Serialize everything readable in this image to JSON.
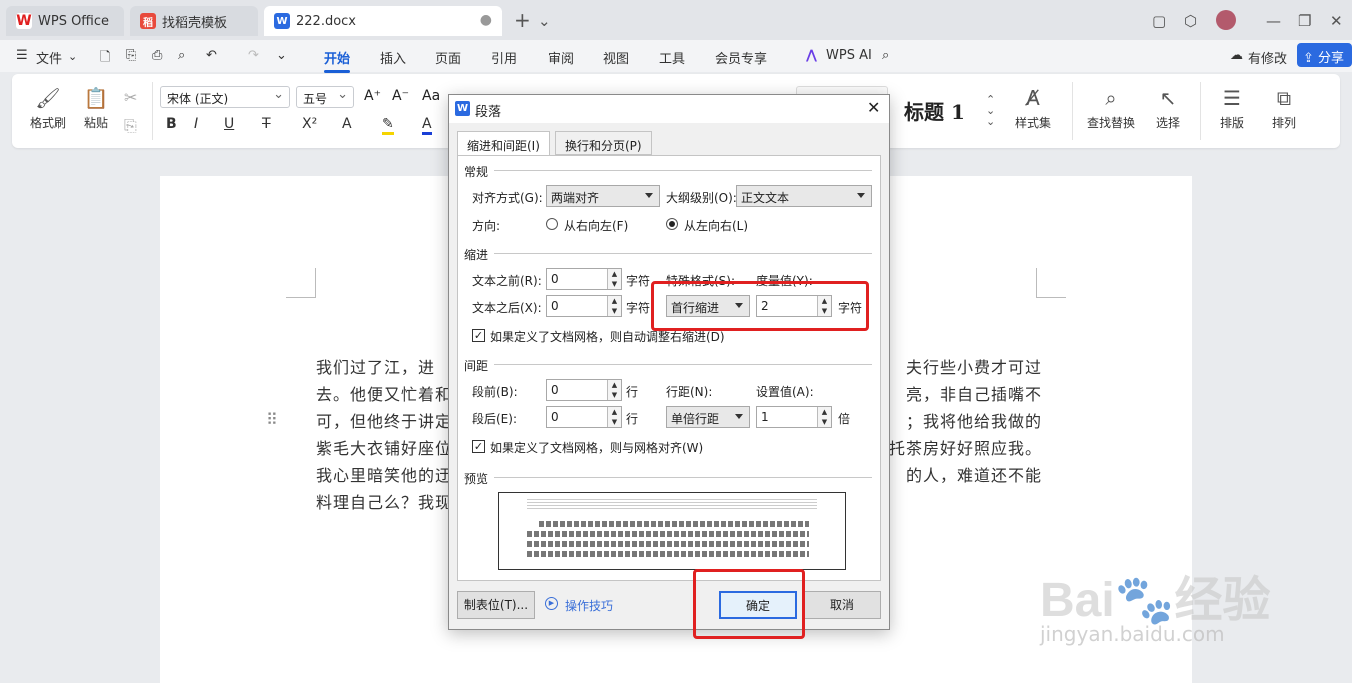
{
  "tabs": [
    {
      "label": "WPS Office",
      "icon": "wps-logo-icon"
    },
    {
      "label": "找稻壳模板",
      "icon": "docer-icon"
    },
    {
      "label": "222.docx",
      "icon": "word-doc-icon"
    }
  ],
  "window": {
    "add_tab": "+"
  },
  "menu": {
    "file": "文件",
    "items": [
      "开始",
      "插入",
      "页面",
      "引用",
      "审阅",
      "视图",
      "工具",
      "会员专享"
    ],
    "active": "开始",
    "wps_ai": "WPS AI",
    "modified": "有修改",
    "share": "分享"
  },
  "ribbon": {
    "format_painter": "格式刷",
    "paste": "粘贴",
    "font_name": "宋体 (正文)",
    "font_size": "五号",
    "style_heading": "标题 1",
    "styles": "样式集",
    "find_replace": "查找替换",
    "select": "选择",
    "layout": "排版",
    "arrange": "排列"
  },
  "document": {
    "lines": [
      "我们过了江，进",
      "去。他便又忙着和",
      "可，但他终于讲定",
      "紫毛大衣铺好座位",
      "我心里暗笑他的迂",
      "料理自己么？我现"
    ],
    "lines_right": [
      "夫行些小费才可过",
      "亮，非自己插嘴不",
      "；我将他给我做的",
      "托茶房好好照应我。",
      "的人，难道还不能",
      ""
    ]
  },
  "dialog": {
    "title": "段落",
    "tabs": [
      "缩进和间距(I)",
      "换行和分页(P)"
    ],
    "general": {
      "section": "常规",
      "alignment_label": "对齐方式(G):",
      "alignment_value": "两端对齐",
      "outline_label": "大纲级别(O):",
      "outline_value": "正文文本",
      "direction_label": "方向:",
      "rtl": "从右向左(F)",
      "ltr": "从左向右(L)"
    },
    "indent": {
      "section": "缩进",
      "before_label": "文本之前(R):",
      "before_value": "0",
      "before_unit": "字符",
      "after_label": "文本之后(X):",
      "after_value": "0",
      "after_unit": "字符",
      "special_label": "特殊格式(S):",
      "special_value": "首行缩进",
      "measure_label": "度量值(Y):",
      "measure_value": "2",
      "measure_unit": "字符",
      "auto_adjust": "如果定义了文档网格，则自动调整右缩进(D)"
    },
    "spacing": {
      "section": "间距",
      "before_label": "段前(B):",
      "before_value": "0",
      "before_unit": "行",
      "after_label": "段后(E):",
      "after_value": "0",
      "after_unit": "行",
      "line_label": "行距(N):",
      "line_value": "单倍行距",
      "set_label": "设置值(A):",
      "set_value": "1",
      "set_unit": "倍",
      "snap_grid": "如果定义了文档网格，则与网格对齐(W)"
    },
    "preview": {
      "section": "预览"
    },
    "tabs_button": "制表位(T)...",
    "tips": "操作技巧",
    "ok": "确定",
    "cancel": "取消"
  },
  "watermark": {
    "brand": "Bai",
    "brand_suffix": "经验",
    "url": "jingyan.baidu.com"
  }
}
